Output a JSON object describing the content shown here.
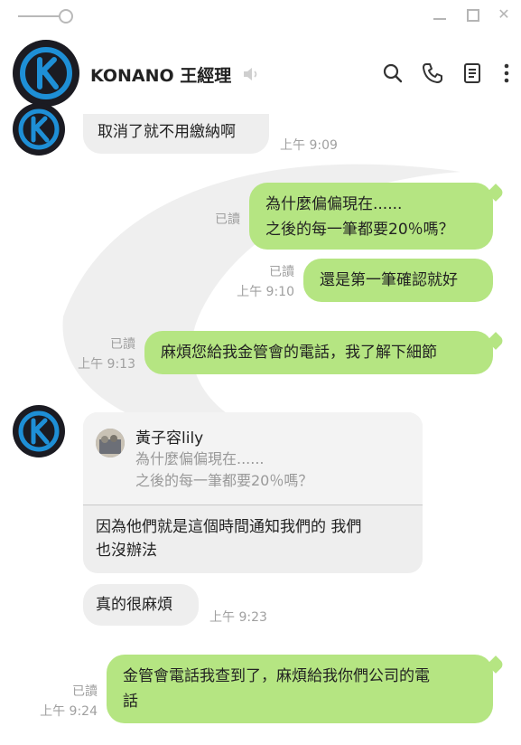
{
  "window": {
    "controls": [
      "minimize-icon",
      "maximize-icon",
      "close-icon"
    ]
  },
  "header": {
    "name": "KONANO 王經理",
    "icons": [
      "search-icon",
      "phone-icon",
      "notes-icon",
      "more-icon",
      "speaker-muted-icon"
    ]
  },
  "messages": {
    "m1": {
      "text": "取消了就不用繳納啊",
      "time": "上午 9:09"
    },
    "m2": {
      "line1": "為什麼偏偏現在......",
      "line2": "之後的每一筆都要20％嗎？",
      "read": "已讀"
    },
    "m3": {
      "text": "還是第一筆確認就好",
      "read": "已讀",
      "time": "上午 9:10"
    },
    "m4": {
      "text": "麻煩您給我金管會的電話，我了解下細節",
      "read": "已讀",
      "time": "上午 9:13"
    },
    "m5": {
      "reply_name": "黃子容lily",
      "quote_line1": "為什麼偏偏現在......",
      "quote_line2": "之後的每一筆都要20％嗎？",
      "body_line1": "因為他們就是這個時間通知我們的 我們",
      "body_line2": "也沒辦法"
    },
    "m6": {
      "text": "真的很麻煩",
      "time": "上午 9:23"
    },
    "m7": {
      "line1": "金管會電話我查到了，麻煩給我你們公司的電",
      "line2": "話",
      "read": "已讀",
      "time": "上午 9:24"
    }
  },
  "colors": {
    "outgoing": "#b5e582",
    "incoming": "#eeeeee",
    "meta": "#a0a0a0"
  }
}
